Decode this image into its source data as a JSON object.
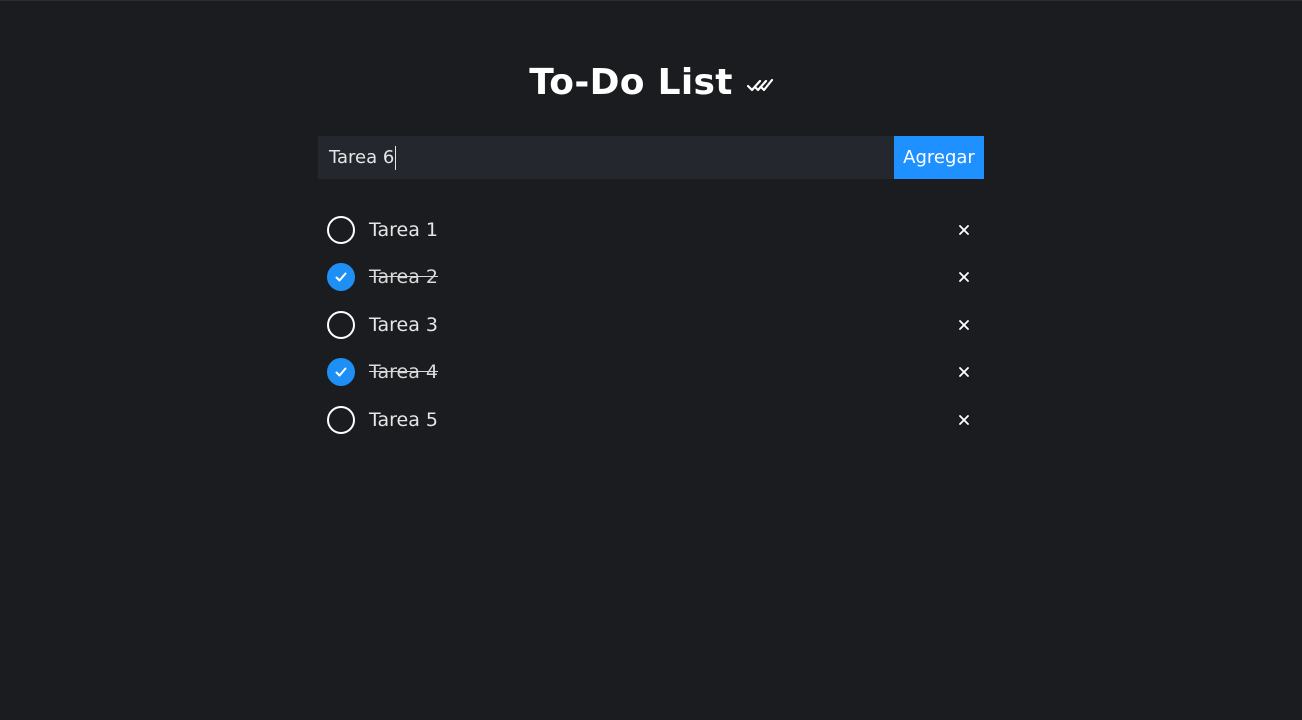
{
  "app": {
    "title": "To-Do List",
    "title_icon": "double-check-icon"
  },
  "form": {
    "input_value": "Tarea 6",
    "add_label": "Agregar"
  },
  "colors": {
    "background": "#1b1c20",
    "input_background": "#25272e",
    "accent": "#1e90ff"
  },
  "tasks": [
    {
      "label": "Tarea 1",
      "done": false
    },
    {
      "label": "Tarea 2",
      "done": true
    },
    {
      "label": "Tarea 3",
      "done": false
    },
    {
      "label": "Tarea 4",
      "done": true
    },
    {
      "label": "Tarea 5",
      "done": false
    }
  ]
}
